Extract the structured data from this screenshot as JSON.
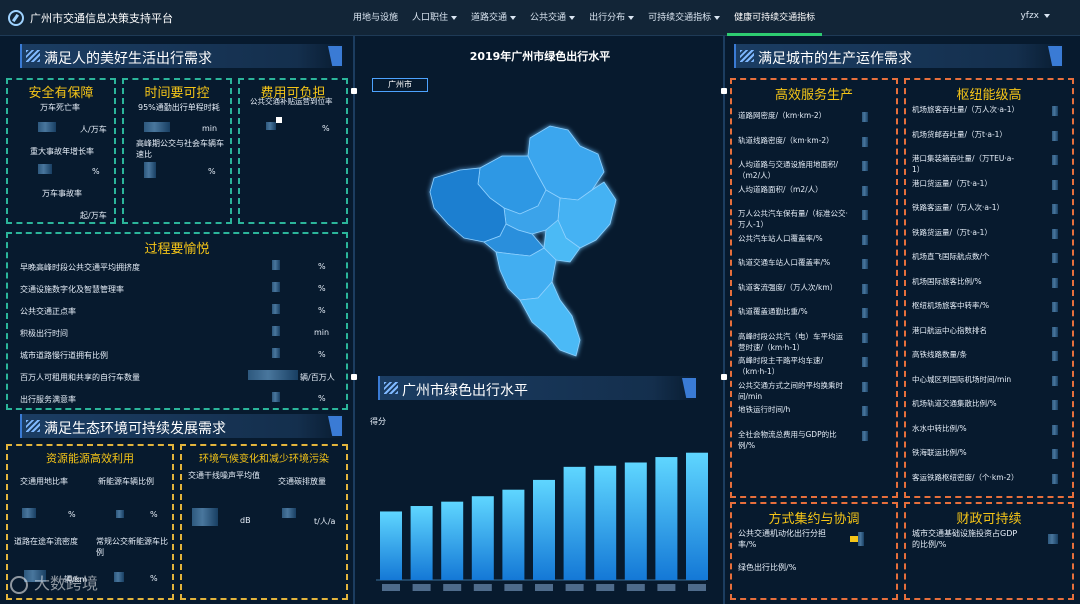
{
  "app": {
    "title": "广州市交通信息决策支持平台",
    "user": "yfzx"
  },
  "nav": [
    {
      "label": "用地与设施",
      "caret": false
    },
    {
      "label": "人口职住",
      "caret": true
    },
    {
      "label": "道路交通",
      "caret": true
    },
    {
      "label": "公共交通",
      "caret": true
    },
    {
      "label": "出行分布",
      "caret": true
    },
    {
      "label": "可持续交通指标",
      "caret": true
    },
    {
      "label": "健康可持续交通指标",
      "caret": false,
      "active": true
    }
  ],
  "left": {
    "header": "满足人的美好生活出行需求",
    "safety": {
      "title": "安全有保障",
      "m1_label": "万车死亡率",
      "m1_unit": "人/万车",
      "m2_label": "重大事故年增长率",
      "m2_unit": "%",
      "m3_label": "万车事故率",
      "m3_unit": "起/万车"
    },
    "time": {
      "title": "时间要可控",
      "m1_label": "95%通勤出行单程时耗",
      "m1_unit": "min",
      "m2_label": "高峰期公交与社会车辆车速比",
      "m2_unit": "%"
    },
    "cost": {
      "title": "费用可负担",
      "m1_label": "公共交通补贴运营到位率",
      "m1_unit": "%"
    },
    "process": {
      "title": "过程要愉悦",
      "rows": [
        {
          "label": "早晚高峰时段公共交通平均拥挤度",
          "unit": "%"
        },
        {
          "label": "交通设施数字化及智慧管理率",
          "unit": "%"
        },
        {
          "label": "公共交通正点率",
          "unit": "%"
        },
        {
          "label": "积极出行时间",
          "unit": "min"
        },
        {
          "label": "城市道路慢行道拥有比例",
          "unit": "%"
        },
        {
          "label": "百万人可租用和共享的自行车数量",
          "unit": "辆/百万人"
        },
        {
          "label": "出行服务满意率",
          "unit": "%"
        }
      ]
    },
    "eco_header": "满足生态环境可持续发展需求",
    "resource": {
      "title": "资源能源高效利用",
      "m1_label": "交通用地比率",
      "m1_unit": "%",
      "m2_label": "新能源车辆比例",
      "m2_unit": "%",
      "m3_label": "道路在途车流密度",
      "m3_unit": "辆/km",
      "m4_label": "常规公交新能源车比例",
      "m4_unit": "%"
    },
    "climate": {
      "title": "环境气候变化和减少环境污染",
      "m1_label": "交通干线噪声平均值",
      "m1_unit": "dB",
      "m2_label": "交通碳排放量",
      "m2_unit": "t/人/a"
    }
  },
  "center": {
    "map_title": "2019年广州市绿色出行水平",
    "city_tag": "广州市",
    "chart_header": "广州市绿色出行水平",
    "chart_ylabel": "得分"
  },
  "chart_data": {
    "type": "bar",
    "categories": [
      "",
      "",
      "",
      "",
      "",
      "",
      "",
      "",
      "",
      ""
    ],
    "values": [
      63,
      68,
      72,
      77,
      83,
      92,
      104,
      105,
      108,
      113,
      117
    ],
    "ylim": [
      0,
      125
    ],
    "grid": false,
    "bar_color_top": "#5fd6ff",
    "bar_color_bottom": "#1478d6"
  },
  "right": {
    "header": "满足城市的生产运作需求",
    "service": {
      "title": "高效服务生产",
      "rows": [
        "道路网密度/（km·km-2）",
        "轨道线路密度/（km·km-2）",
        "人均道路与交通设施用地面积/（m2/人）",
        "人均道路面积/（m2/人）",
        "万人公共汽车保有量/（标准公交·万人-1）",
        "公共汽车站人口覆盖率/%",
        "轨道交通车站人口覆盖率/%",
        "轨道客流强度/（万人次/km）",
        "轨道覆盖通勤比重/%",
        "高峰时段公共汽（电）车平均运营时速/（km·h-1）",
        "高峰时段主干路平均车速/（km·h-1）",
        "公共交通方式之间的平均换乘时间/min",
        "地铁运行时间/h",
        "全社会物流总费用与GDP的比例/%"
      ]
    },
    "hub": {
      "title": "枢纽能级高",
      "rows": [
        "机场旅客吞吐量/（万人次·a-1）",
        "机场货邮吞吐量/（万t·a-1）",
        "港口集装箱吞吐量/（万TEU·a-1）",
        "港口货运量/（万t·a-1）",
        "铁路客运量/（万人次·a-1）",
        "铁路货运量/（万t·a-1）",
        "机场直飞国际航点数/个",
        "机场国际旅客比例/%",
        "枢纽机场旅客中转率/%",
        "港口航运中心指数排名",
        "高铁线路数量/条",
        "中心城区到国际机场时间/min",
        "机场轨道交通集散比例/%",
        "水水中转比例/%",
        "铁海联运比例/%",
        "客运铁路枢纽密度/（个·km-2）"
      ]
    },
    "mode": {
      "title": "方式集约与协调",
      "rows": [
        "公共交通机动化出行分担率/%",
        "绿色出行比例/%"
      ]
    },
    "finance": {
      "title": "财政可持续",
      "rows": [
        "城市交通基础设施投资占GDP的比例/%"
      ]
    }
  },
  "watermark": "大数跨境",
  "colors": {
    "background": "#071a2e",
    "accent": "#3a7bd5",
    "title_yellow": "#f5c518",
    "green": "#2bb59a",
    "orange": "#e76f3c"
  }
}
